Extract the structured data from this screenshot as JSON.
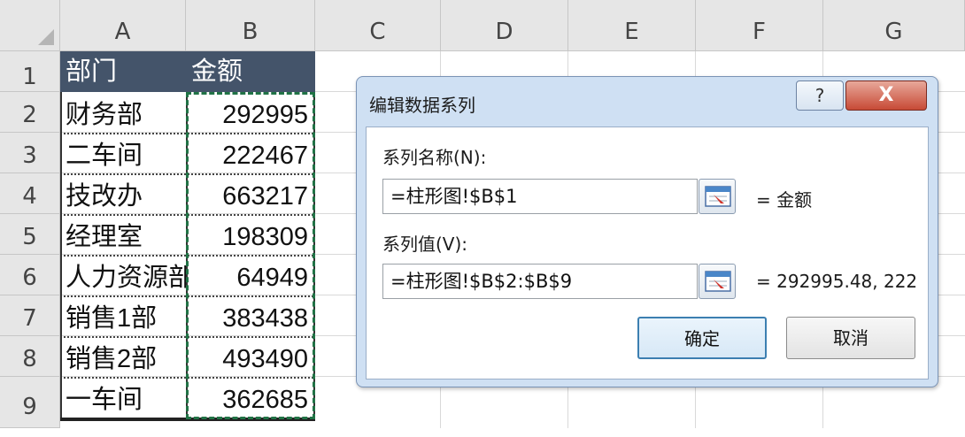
{
  "spreadsheet": {
    "columns": [
      "A",
      "B",
      "C",
      "D",
      "E",
      "F",
      "G"
    ],
    "rows": [
      "1",
      "2",
      "3",
      "4",
      "5",
      "6",
      "7",
      "8",
      "9"
    ],
    "header": {
      "dept": "部门",
      "amount": "金额"
    },
    "data": [
      {
        "dept": "财务部",
        "amount": "292995"
      },
      {
        "dept": "二车间",
        "amount": "222467"
      },
      {
        "dept": "技改办",
        "amount": "663217"
      },
      {
        "dept": "经理室",
        "amount": "198309"
      },
      {
        "dept": "人力资源部",
        "amount": "64949"
      },
      {
        "dept": "销售1部",
        "amount": "383438"
      },
      {
        "dept": "销售2部",
        "amount": "493490"
      },
      {
        "dept": "一车间",
        "amount": "362685"
      }
    ]
  },
  "dialog": {
    "title": "编辑数据系列",
    "help_label": "?",
    "close_label": "X",
    "series_name_label": "系列名称(N):",
    "series_name_value": "=柱形图!$B$1",
    "series_name_preview": "= 金额",
    "series_values_label": "系列值(V):",
    "series_values_value": "=柱形图!$B$2:$B$9",
    "series_values_preview": "= 292995.48, 222",
    "ok_label": "确定",
    "cancel_label": "取消",
    "ref_button_icon": "collapse-dialog-icon"
  },
  "colors": {
    "header_fill": "#44546a",
    "marquee": "#217346",
    "dialog_bg": "#cfe0f3",
    "close_button": "#c74a36"
  }
}
